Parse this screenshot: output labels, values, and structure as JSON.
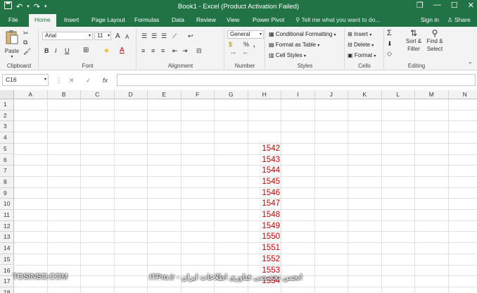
{
  "window": {
    "title": "Book1 - Excel (Product Activation Failed)",
    "controls": {
      "restore": "❐",
      "minimize": "—",
      "maximize": "☐",
      "close": "✕"
    }
  },
  "tabs": [
    "File",
    "Home",
    "Insert",
    "Page Layout",
    "Formulas",
    "Data",
    "Review",
    "View",
    "Power Pivot"
  ],
  "active_tab": "Home",
  "tell_me": "Tell me what you want to do...",
  "account": {
    "sign_in": "Sign in",
    "share": "Share"
  },
  "ribbon": {
    "clipboard": {
      "label": "Clipboard",
      "paste": "Paste"
    },
    "font": {
      "label": "Font",
      "font_name": "Arial",
      "font_size": "11",
      "bold": "B",
      "italic": "I",
      "underline": "U",
      "grow": "A",
      "shrink": "A"
    },
    "alignment": {
      "label": "Alignment"
    },
    "number": {
      "label": "Number",
      "format": "General",
      "percent": "%",
      "comma": ","
    },
    "styles": {
      "label": "Styles",
      "conditional": "Conditional Formatting",
      "format_table": "Format as Table",
      "cell_styles": "Cell Styles"
    },
    "cells": {
      "label": "Cells",
      "insert": "Insert",
      "delete": "Delete",
      "format": "Format"
    },
    "editing": {
      "label": "Editing",
      "sort_filter_1": "Sort &",
      "sort_filter_2": "Filter",
      "find_select_1": "Find &",
      "find_select_2": "Select"
    }
  },
  "formula_bar": {
    "name_box": "C16",
    "fx": "fx",
    "content": ""
  },
  "columns": [
    "A",
    "B",
    "C",
    "D",
    "E",
    "F",
    "G",
    "H",
    "I",
    "J",
    "K",
    "L",
    "M",
    "N"
  ],
  "rows": [
    "1",
    "2",
    "3",
    "4",
    "5",
    "6",
    "7",
    "8",
    "9",
    "10",
    "11",
    "12",
    "13",
    "14",
    "15",
    "16",
    "17",
    "18"
  ],
  "column_h_values": [
    {
      "row": "5",
      "value": "1542"
    },
    {
      "row": "6",
      "value": "1543"
    },
    {
      "row": "7",
      "value": "1544"
    },
    {
      "row": "8",
      "value": "1545"
    },
    {
      "row": "9",
      "value": "1546"
    },
    {
      "row": "10",
      "value": "1547"
    },
    {
      "row": "11",
      "value": "1548"
    },
    {
      "row": "12",
      "value": "1549"
    },
    {
      "row": "13",
      "value": "1550"
    },
    {
      "row": "14",
      "value": "1551"
    },
    {
      "row": "15",
      "value": "1552"
    },
    {
      "row": "16",
      "value": "1553"
    },
    {
      "row": "17",
      "value": "1554"
    }
  ],
  "watermark": {
    "left": "TOSINSO.COM",
    "right": "انجمن تخصصی فناوری اطلاعات ایران - ITPro.ir"
  },
  "colors": {
    "excel_green": "#217346",
    "value_red": "#c00000"
  }
}
